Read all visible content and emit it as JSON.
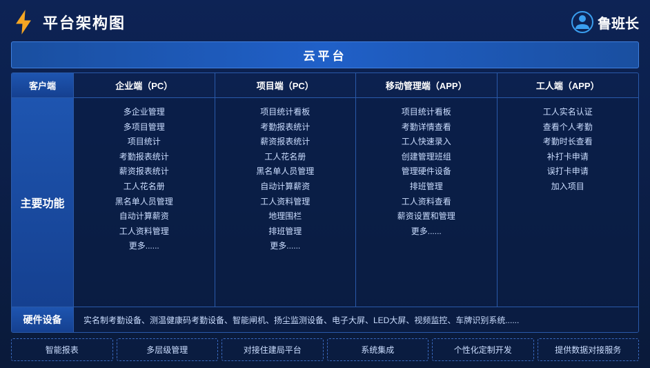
{
  "header": {
    "title": "平台架构图",
    "brand_name": "鲁班长"
  },
  "cloud_platform": {
    "label": "云平台"
  },
  "columns": {
    "client": "客户端",
    "enterprise_pc": "企业端（PC）",
    "project_pc": "项目端（PC）",
    "mobile_app": "移动管理端（APP）",
    "worker_app": "工人端（APP）"
  },
  "main_function_label": "主要功能",
  "enterprise_features": [
    "多企业管理",
    "多项目管理",
    "项目统计",
    "考勤报表统计",
    "薪资报表统计",
    "工人花名册",
    "黑名单人员管理",
    "自动计算薪资",
    "工人资料管理",
    "更多......"
  ],
  "project_features": [
    "项目统计看板",
    "考勤报表统计",
    "薪资报表统计",
    "工人花名册",
    "黑名单人员管理",
    "自动计算薪资",
    "工人资料管理",
    "地理围栏",
    "排班管理",
    "更多......"
  ],
  "mobile_features": [
    "项目统计看板",
    "考勤详情查看",
    "工人快速录入",
    "创建管理班组",
    "管理硬件设备",
    "排班管理",
    "工人资料查看",
    "薪资设置和管理",
    "更多......"
  ],
  "worker_features": [
    "工人实名认证",
    "查看个人考勤",
    "考勤时长查看",
    "补打卡申请",
    "误打卡申请",
    "加入项目"
  ],
  "hardware": {
    "label": "硬件设备",
    "content": "实名制考勤设备、测温健康码考勤设备、智能闸机、扬尘监测设备、电子大屏、LED大屏、视频监控、车牌识别系统......"
  },
  "features": [
    "智能报表",
    "多层级管理",
    "对接住建局平台",
    "系统集成",
    "个性化定制开发",
    "提供数据对接服务"
  ]
}
